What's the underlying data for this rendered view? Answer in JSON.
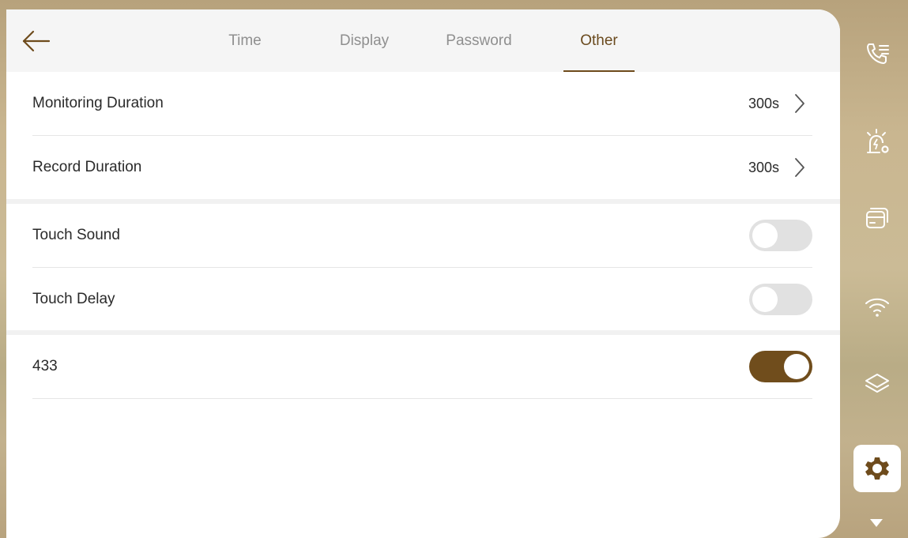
{
  "tabs": [
    {
      "label": "Time",
      "active": false
    },
    {
      "label": "Display",
      "active": false
    },
    {
      "label": "Password",
      "active": false
    },
    {
      "label": "Other",
      "active": true
    }
  ],
  "settings": {
    "monitoring_duration": {
      "label": "Monitoring Duration",
      "value": "300s"
    },
    "record_duration": {
      "label": "Record Duration",
      "value": "300s"
    },
    "touch_sound": {
      "label": "Touch Sound",
      "enabled": false
    },
    "touch_delay": {
      "label": "Touch Delay",
      "enabled": false
    },
    "rf_433": {
      "label": "433",
      "enabled": true
    }
  },
  "sidebar": {
    "items": [
      {
        "icon": "call-settings-icon"
      },
      {
        "icon": "alarm-settings-icon"
      },
      {
        "icon": "card-icon"
      },
      {
        "icon": "wifi-icon"
      },
      {
        "icon": "layers-icon"
      },
      {
        "icon": "settings-gear-icon",
        "active": true
      }
    ]
  },
  "colors": {
    "accent": "#704d1c",
    "active_tab_text": "#6a4a1e",
    "inactive_tab_text": "#8f8f8f",
    "toggle_off": "#e1e1e1"
  }
}
